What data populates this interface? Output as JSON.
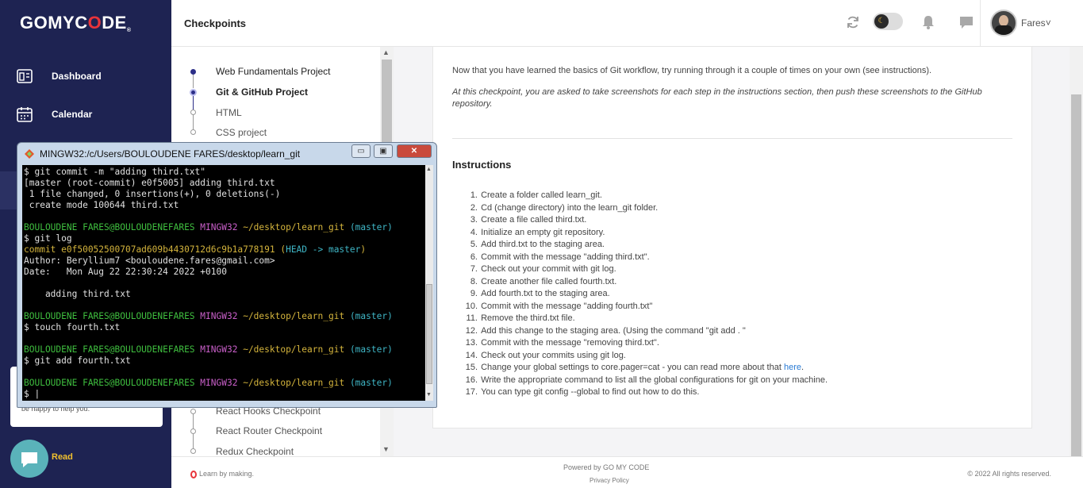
{
  "sidebar": {
    "logo_pre": "GOMYC",
    "logo_red": "O",
    "logo_post": "DE",
    "logo_mark": "®",
    "items": [
      {
        "label": "Dashboard",
        "icon": "dashboard-icon"
      },
      {
        "label": "Calendar",
        "icon": "calendar-icon"
      }
    ],
    "chat_text": "be happy to help you.",
    "read_label": "Read"
  },
  "header": {
    "title": "Checkpoints",
    "user_name": "Fares",
    "user_chevron": "˅"
  },
  "checkpoints": [
    "Web Fundamentals Project",
    "Git & GitHub Project",
    "HTML",
    "CSS project",
    "React Hooks Checkpoint",
    "React Router Checkpoint",
    "Redux Checkpoint"
  ],
  "content": {
    "intro": "Now that you have learned the basics of Git workflow, try running through it a couple of times on your own (see instructions).",
    "intro2": "At this checkpoint, you are asked to take screenshots for each step in the instructions section, then push these screenshots to the GitHub repository.",
    "instructions_title": "Instructions",
    "steps": [
      "Create a folder called learn_git.",
      "Cd (change directory) into the learn_git folder.",
      "Create a file called third.txt.",
      "Initialize an empty git repository.",
      "Add third.txt to the staging area.",
      "Commit with the message \"adding third.txt\".",
      "Check out your commit with git log.",
      "Create another file called fourth.txt.",
      "Add fourth.txt to the staging area.",
      "Commit with the message \"adding fourth.txt\"",
      "Remove the third.txt file.",
      "Add this change to the staging area. (Using the command \"git add . \"",
      "Commit with the message \"removing third.txt\".",
      "Check out your commits using git log.",
      "Change your global settings to core.pager=cat - you can read more about that ",
      "Write the appropriate command to list all the global configurations for git on your machine.",
      "You can type git config --global to find out how to do this."
    ],
    "step15_link": "here",
    "step15_end": "."
  },
  "footer": {
    "left": "Learn by making.",
    "powered": "Powered by GO MY CODE",
    "privacy": "Privacy Policy",
    "copyright": "© 2022 All rights reserved."
  },
  "terminal": {
    "title": "MINGW32:/c/Users/BOULOUDENE FARES/desktop/learn_git",
    "win_min": "▭",
    "win_max": "▣",
    "win_close": "✕",
    "user": "BOULOUDENE FARES@BOULOUDENEFARES",
    "env": "MINGW32",
    "path": "~/desktop/learn_git",
    "branch": "(master)",
    "l1": "$ git commit -m \"adding third.txt\"",
    "l2": "[master (root-commit) e0f5005] adding third.txt",
    "l3": " 1 file changed, 0 insertions(+), 0 deletions(-)",
    "l4": " create mode 100644 third.txt",
    "l6": "$ git log",
    "commit": "commit e0f50052500707ad609b4430712d6c9b1a778191",
    "head_open": "(",
    "head": "HEAD -> master",
    "head_close": ")",
    "author": "Author: Beryllium7 <bouloudene.fares@gmail.com>",
    "date": "Date:   Mon Aug 22 22:30:24 2022 +0100",
    "msg": "    adding third.txt",
    "cmd_touch": "$ touch fourth.txt",
    "cmd_add": "$ git add fourth.txt",
    "prompt": "$ |"
  }
}
